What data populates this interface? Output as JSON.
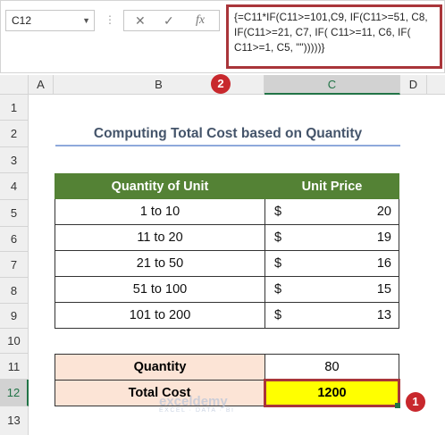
{
  "formula_bar": {
    "name_box": "C12",
    "fx_label": "fx",
    "formula_lines": [
      "{=C11*IF(C11>=101,C9, IF(C11>=51, C8,",
      "IF(C11>=21, C7, IF( C11>=11, C6, IF(",
      "C11>=1, C5, \"\")))))}"
    ]
  },
  "columns": [
    "A",
    "B",
    "C",
    "D"
  ],
  "rows": [
    "1",
    "2",
    "3",
    "4",
    "5",
    "6",
    "7",
    "8",
    "9",
    "10",
    "11",
    "12",
    "13"
  ],
  "sheet": {
    "title": "Computing Total Cost based on Quantity",
    "headers": [
      "Quantity of Unit",
      "Unit Price"
    ],
    "currency_symbol": "$",
    "table_rows": [
      {
        "qty": "1 to 10",
        "price": "20"
      },
      {
        "qty": "11 to 20",
        "price": "19"
      },
      {
        "qty": "21 to 50",
        "price": "16"
      },
      {
        "qty": "51 to 100",
        "price": "15"
      },
      {
        "qty": "101 to 200",
        "price": "13"
      }
    ],
    "quantity_label": "Quantity",
    "quantity_value": "80",
    "total_label": "Total Cost",
    "total_value": "1200"
  },
  "badges": [
    "1",
    "2"
  ],
  "watermark": {
    "name": "exceldemy",
    "tagline": "EXCEL · DATA · BI"
  },
  "colors": {
    "header_green": "#548235",
    "highlight_yellow": "#ffff00",
    "label_peach": "#fce4d6",
    "callout_red": "#c8282d"
  }
}
